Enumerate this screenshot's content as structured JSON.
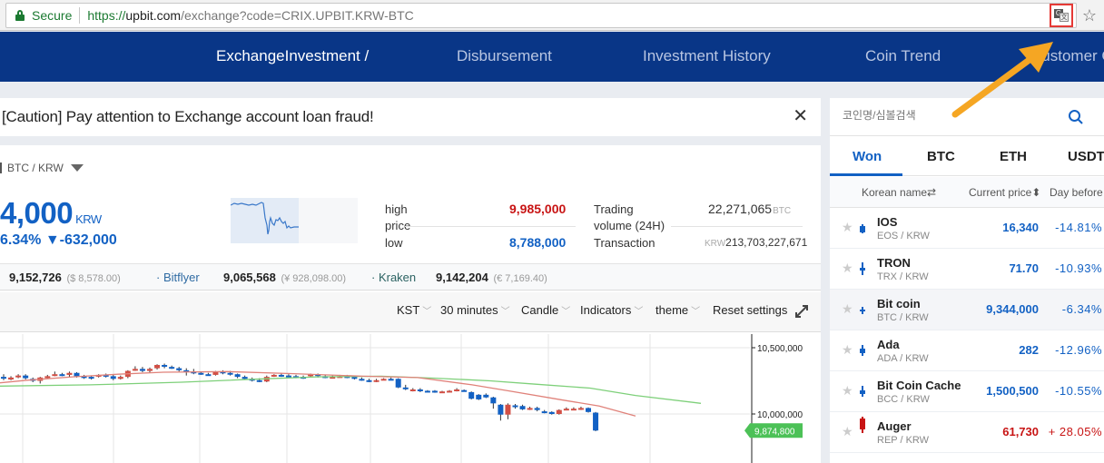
{
  "browser": {
    "secure_label": "Secure",
    "url_scheme": "https://",
    "url_host": "upbit.com",
    "url_path": "/exchange?code=CRIX.UPBIT.KRW-BTC",
    "translate_icon": "translate-icon",
    "bookmark_icon": "star-icon"
  },
  "nav": {
    "items": [
      {
        "label_highlight": "Exchange",
        "label": "Investment /"
      },
      {
        "label": "Disbursement"
      },
      {
        "label": "Investment History"
      },
      {
        "label": "Coin Trend"
      },
      {
        "label": "Customer C"
      }
    ]
  },
  "notice": {
    "text": "[Caution] Pay attention to Exchange account loan fraud!",
    "close_icon": "close-icon"
  },
  "market": {
    "pair": "BTC / KRW",
    "price": "4,000",
    "price_unit": "KRW",
    "change": "6.34% ▼-632,000",
    "high_label_1": "high",
    "high_label_2": "price",
    "high_value": "9,985,000",
    "low_label": "low",
    "low_value": "8,788,000",
    "volume_label_1": "Trading",
    "volume_label_2": "volume (24H)",
    "volume_value": "22,271,065",
    "volume_unit": "BTC",
    "transaction_label": "Transaction",
    "transaction_unit": "KRW",
    "transaction_value": "213,703,227,671"
  },
  "exchanges": [
    {
      "price": "9,152,726",
      "sub": "($ 8,578.00)",
      "name": ""
    },
    {
      "name": "· Bitflyer",
      "price": "9,065,568",
      "sub": "(¥ 928,098.00)"
    },
    {
      "name": "· Kraken",
      "price": "9,142,204",
      "sub": "(€ 7,169.40)"
    }
  ],
  "toolbar": {
    "timezone": "KST",
    "interval": "30 minutes",
    "chart_type": "Candle",
    "indicators": "Indicators",
    "theme": "theme",
    "reset": "Reset settings"
  },
  "chart": {
    "y_ticks": [
      "10,500,000",
      "10,000,000"
    ],
    "current_price_tag": "9,874,800",
    "up_color": "#d24f45",
    "down_color": "#1261c4",
    "ma_short_color": "#e0827a",
    "ma_long_color": "#7ed07a",
    "tag_color": "#4cc157"
  },
  "sidebar": {
    "search_placeholder": "코인명/심볼검색",
    "tabs": [
      "Won",
      "BTC",
      "ETH",
      "USDT"
    ],
    "columns": [
      "Korean name⇄",
      "Current price⬍",
      "Day before⬍"
    ],
    "rows": [
      {
        "name": "IOS",
        "symbol": "EOS / KRW",
        "price": "16,340",
        "change": "-14.81%",
        "dir": "down"
      },
      {
        "name": "TRON",
        "symbol": "TRX / KRW",
        "price": "71.70",
        "change": "-10.93%",
        "dir": "down"
      },
      {
        "name": "Bit coin",
        "symbol": "BTC / KRW",
        "price": "9,344,000",
        "change": "-6.34%",
        "dir": "down",
        "selected": true
      },
      {
        "name": "Ada",
        "symbol": "ADA / KRW",
        "price": "282",
        "change": "-12.96%",
        "dir": "down"
      },
      {
        "name": "Bit Coin Cache",
        "symbol": "BCC / KRW",
        "price": "1,500,500",
        "change": "-10.55%",
        "dir": "down"
      },
      {
        "name": "Auger",
        "symbol": "REP / KRW",
        "price": "61,730",
        "change": "+ 28.05%",
        "dir": "up"
      }
    ]
  },
  "colors": {
    "nav_bg": "#093687",
    "accent_blue": "#1261c4",
    "red": "#c81414",
    "annotation_arrow": "#f5a623",
    "highlight_box": "#e53935"
  }
}
